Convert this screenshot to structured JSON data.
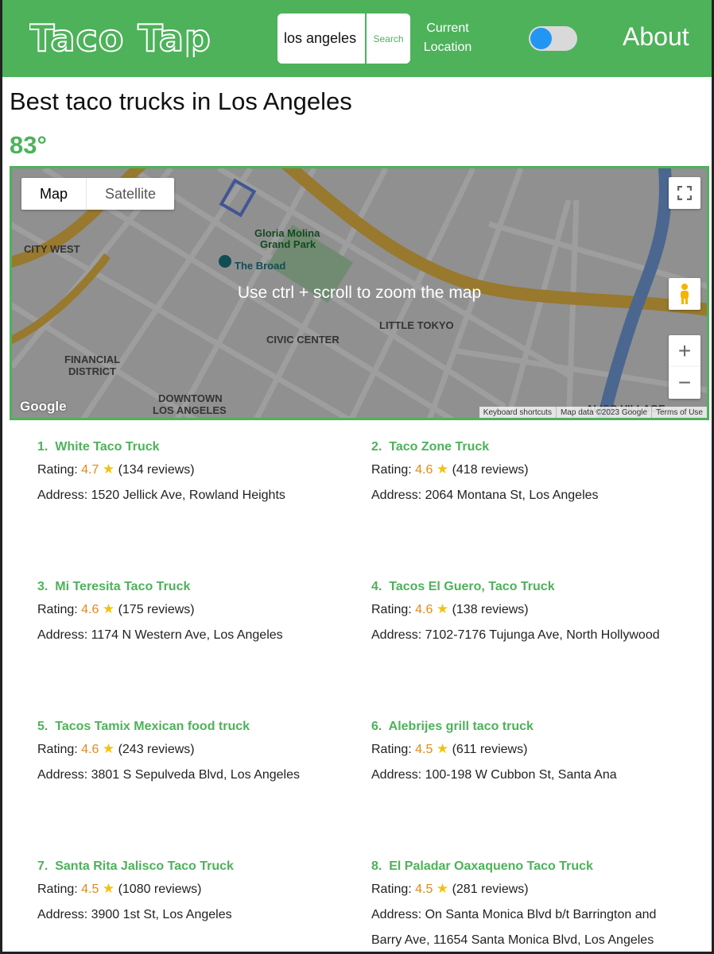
{
  "header": {
    "logo_text": "Taco Tap",
    "search_value": "los angeles",
    "search_button": "Search",
    "current_location_line1": "Current",
    "current_location_line2": "Location",
    "about": "About",
    "brand_color": "#4db25a",
    "toggle_color": "#2196f3",
    "toggle_on": true
  },
  "page": {
    "title": "Best taco trucks in Los Angeles",
    "temperature": "83°"
  },
  "map": {
    "hint": "Use ctrl + scroll to zoom the map",
    "type_map": "Map",
    "type_satellite": "Satellite",
    "google_logo": "Google",
    "footer": [
      "Keyboard shortcuts",
      "Map data ©2023 Google",
      "Terms of Use"
    ],
    "labels": {
      "city_west": "CITY WEST",
      "financial_district": "FINANCIAL",
      "financial_district_2": "DISTRICT",
      "civic_center": "CIVIC CENTER",
      "little_tokyo": "LITTLE TOKYO",
      "downtown": "DOWNTOWN",
      "downtown_2": "LOS ANGELES",
      "gloria": "Gloria Molina",
      "gloria_2": "Grand Park",
      "the_broad": "The Broad",
      "aliso": "ALISO VILLAGE"
    }
  },
  "trucks": [
    {
      "rank": "1.",
      "name": "White Taco Truck",
      "rating_label": "Rating:",
      "rating": "4.7",
      "reviews": "(134 reviews)",
      "address_label": "Address:",
      "address": "1520 Jellick Ave, Rowland Heights"
    },
    {
      "rank": "2.",
      "name": "Taco Zone Truck",
      "rating_label": "Rating:",
      "rating": "4.6",
      "reviews": "(418 reviews)",
      "address_label": "Address:",
      "address": "2064 Montana St, Los Angeles"
    },
    {
      "rank": "3.",
      "name": "Mi Teresita Taco Truck",
      "rating_label": "Rating:",
      "rating": "4.6",
      "reviews": "(175 reviews)",
      "address_label": "Address:",
      "address": "1174 N Western Ave, Los Angeles"
    },
    {
      "rank": "4.",
      "name": "Tacos El Guero, Taco Truck",
      "rating_label": "Rating:",
      "rating": "4.6",
      "reviews": "(138 reviews)",
      "address_label": "Address:",
      "address": "7102-7176 Tujunga Ave, North Hollywood"
    },
    {
      "rank": "5.",
      "name": "Tacos Tamix Mexican food truck",
      "rating_label": "Rating:",
      "rating": "4.6",
      "reviews": "(243 reviews)",
      "address_label": "Address:",
      "address": "3801 S Sepulveda Blvd, Los Angeles"
    },
    {
      "rank": "6.",
      "name": "Alebrijes grill taco truck",
      "rating_label": "Rating:",
      "rating": "4.5",
      "reviews": "(611 reviews)",
      "address_label": "Address:",
      "address": "100-198 W Cubbon St, Santa Ana"
    },
    {
      "rank": "7.",
      "name": "Santa Rita Jalisco Taco Truck",
      "rating_label": "Rating:",
      "rating": "4.5",
      "reviews": "(1080 reviews)",
      "address_label": "Address:",
      "address": "3900 1st St, Los Angeles"
    },
    {
      "rank": "8.",
      "name": "El Paladar Oaxaqueno Taco Truck",
      "rating_label": "Rating:",
      "rating": "4.5",
      "reviews": "(281 reviews)",
      "address_label": "Address:",
      "address": "On Santa Monica Blvd b/t Barrington and Barry Ave, 11654 Santa Monica Blvd, Los Angeles"
    }
  ]
}
